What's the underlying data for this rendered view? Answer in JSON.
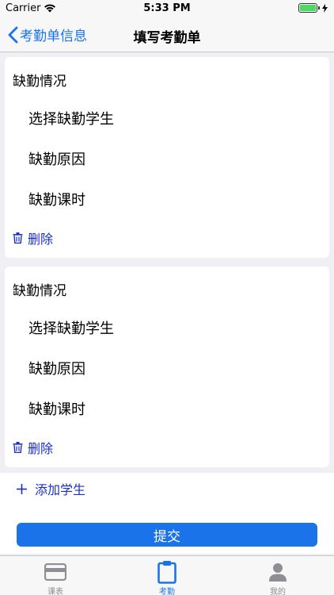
{
  "status_bar": {
    "carrier": "Carrier",
    "time": "5:33 PM"
  },
  "nav": {
    "back_label": "考勤单信息",
    "title": "填写考勤单"
  },
  "absence_cards": [
    {
      "title": "缺勤情况",
      "select_student": "选择缺勤学生",
      "reason": "缺勤原因",
      "hours": "缺勤课时",
      "delete_label": "删除"
    },
    {
      "title": "缺勤情况",
      "select_student": "选择缺勤学生",
      "reason": "缺勤原因",
      "hours": "缺勤课时",
      "delete_label": "删除"
    }
  ],
  "add_student_label": "添加学生",
  "submit_label": "提交",
  "tabs": [
    {
      "label": "课表",
      "icon": "card-icon",
      "active": false
    },
    {
      "label": "考勤",
      "icon": "clipboard-icon",
      "active": true
    },
    {
      "label": "我的",
      "icon": "person-icon",
      "active": false
    }
  ],
  "colors": {
    "accent": "#1a73e8",
    "link": "#1a2fc0",
    "tab_inactive": "#8e8e93"
  }
}
